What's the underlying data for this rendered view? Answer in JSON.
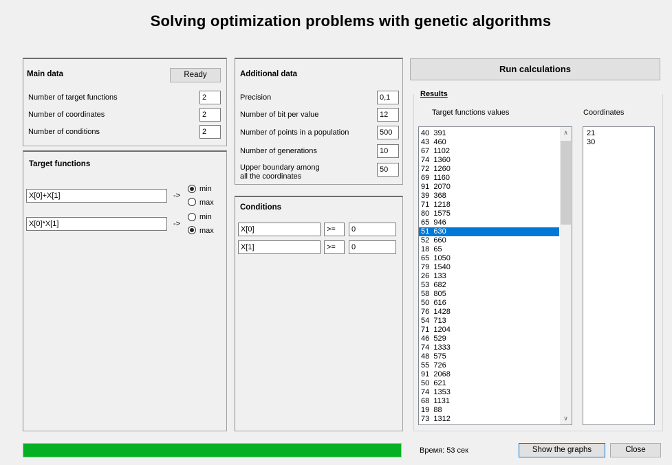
{
  "title": "Solving optimization problems with genetic algorithms",
  "main": {
    "title": "Main data",
    "ready_label": "Ready",
    "fields": [
      {
        "label": "Number of target functions",
        "value": "2"
      },
      {
        "label": "Number of coordinates",
        "value": "2"
      },
      {
        "label": "Number of conditions",
        "value": "2"
      }
    ]
  },
  "target": {
    "title": "Target functions",
    "arrow": "->",
    "min_label": "min",
    "max_label": "max",
    "functions": [
      {
        "expr": "X[0]+X[1]",
        "selected": "min"
      },
      {
        "expr": "X[0]*X[1]",
        "selected": "max"
      }
    ]
  },
  "additional": {
    "title": "Additional data",
    "fields": [
      {
        "label": "Precision",
        "value": "0,1"
      },
      {
        "label": "Number of bit per value",
        "value": "12"
      },
      {
        "label": "Number of points in a population",
        "value": "500"
      },
      {
        "label": "Number of generations",
        "value": "10"
      },
      {
        "label": "Upper boundary among",
        "label2": "all the coordinates",
        "value": "50"
      }
    ]
  },
  "conditions": {
    "title": "Conditions",
    "rows": [
      {
        "left": "X[0]",
        "op": ">=",
        "right": "0"
      },
      {
        "left": "X[1]",
        "op": ">=",
        "right": "0"
      }
    ]
  },
  "run_label": "Run calculations",
  "results": {
    "title": "Results",
    "values_header": "Target functions values",
    "coords_header": "Coordinates",
    "values": [
      "40  391",
      "43  460",
      "67  1102",
      "74  1360",
      "72  1260",
      "69  1160",
      "91  2070",
      "39  368",
      "71  1218",
      "80  1575",
      "65  946",
      "51  630",
      "52  660",
      "18  65",
      "65  1050",
      "79  1540",
      "26  133",
      "53  682",
      "58  805",
      "50  616",
      "76  1428",
      "54  713",
      "71  1204",
      "46  529",
      "74  1333",
      "48  575",
      "55  726",
      "91  2068",
      "50  621",
      "74  1353",
      "68  1131",
      "19  88",
      "73  1312"
    ],
    "selected_index": 11,
    "coordinates": [
      "21",
      "30"
    ]
  },
  "status": {
    "progress": 1.0,
    "progress_color": "#06b025",
    "time_text": "Время: 53 сек"
  },
  "footer": {
    "graphs_label": "Show the graphs",
    "close_label": "Close"
  }
}
